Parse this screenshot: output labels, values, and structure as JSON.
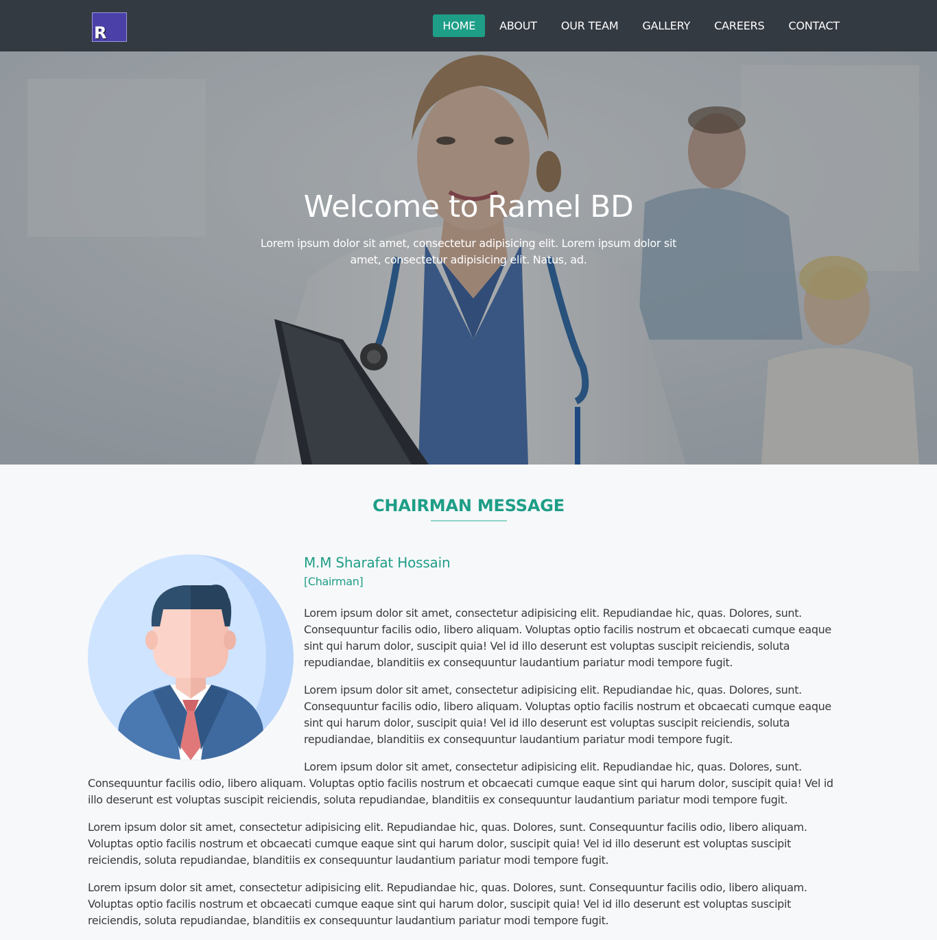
{
  "navbar": {
    "logo_letter": "R",
    "links": [
      {
        "label": "HOME",
        "active": true
      },
      {
        "label": "ABOUT",
        "active": false
      },
      {
        "label": "OUR TEAM",
        "active": false
      },
      {
        "label": "GALLERY",
        "active": false
      },
      {
        "label": "CAREERS",
        "active": false
      },
      {
        "label": "CONTACT",
        "active": false
      }
    ]
  },
  "hero": {
    "title": "Welcome to Ramel BD",
    "subtitle": "Lorem ipsum dolor sit amet, consectetur adipisicing elit. Lorem ipsum dolor sit amet, consectetur adipisicing elit. Natus, ad."
  },
  "chairman": {
    "section_title": "CHAIRMAN MESSAGE",
    "name": "M.M Sharafat Hossain",
    "role": "[Chairman]",
    "paragraphs": [
      "Lorem ipsum dolor sit amet, consectetur adipisicing elit. Repudiandae hic, quas. Dolores, sunt. Consequuntur facilis odio, libero aliquam. Voluptas optio facilis nostrum et obcaecati cumque eaque sint qui harum dolor, suscipit quia! Vel id illo deserunt est voluptas suscipit reiciendis, soluta repudiandae, blanditiis ex consequuntur laudantium pariatur modi tempore fugit.",
      "Lorem ipsum dolor sit amet, consectetur adipisicing elit. Repudiandae hic, quas. Dolores, sunt. Consequuntur facilis odio, libero aliquam. Voluptas optio facilis nostrum et obcaecati cumque eaque sint qui harum dolor, suscipit quia! Vel id illo deserunt est voluptas suscipit reiciendis, soluta repudiandae, blanditiis ex consequuntur laudantium pariatur modi tempore fugit.",
      "Lorem ipsum dolor sit amet, consectetur adipisicing elit. Repudiandae hic, quas. Dolores, sunt. Consequuntur facilis odio, libero aliquam. Voluptas optio facilis nostrum et obcaecati cumque eaque sint qui harum dolor, suscipit quia! Vel id illo deserunt est voluptas suscipit reiciendis, soluta repudiandae, blanditiis ex consequuntur laudantium pariatur modi tempore fugit.",
      "Lorem ipsum dolor sit amet, consectetur adipisicing elit. Repudiandae hic, quas. Dolores, sunt. Consequuntur facilis odio, libero aliquam. Voluptas optio facilis nostrum et obcaecati cumque eaque sint qui harum dolor, suscipit quia! Vel id illo deserunt est voluptas suscipit reiciendis, soluta repudiandae, blanditiis ex consequuntur laudantium pariatur modi tempore fugit.",
      "Lorem ipsum dolor sit amet, consectetur adipisicing elit. Repudiandae hic, quas. Dolores, sunt. Consequuntur facilis odio, libero aliquam. Voluptas optio facilis nostrum et obcaecati cumque eaque sint qui harum dolor, suscipit quia! Vel id illo deserunt est voluptas suscipit reiciendis, soluta repudiandae, blanditiis ex consequuntur laudantium pariatur modi tempore fugit."
    ]
  },
  "colors": {
    "navbar_bg": "#343a42",
    "accent": "#1e9e87",
    "page_bg": "#f7f8fa"
  }
}
